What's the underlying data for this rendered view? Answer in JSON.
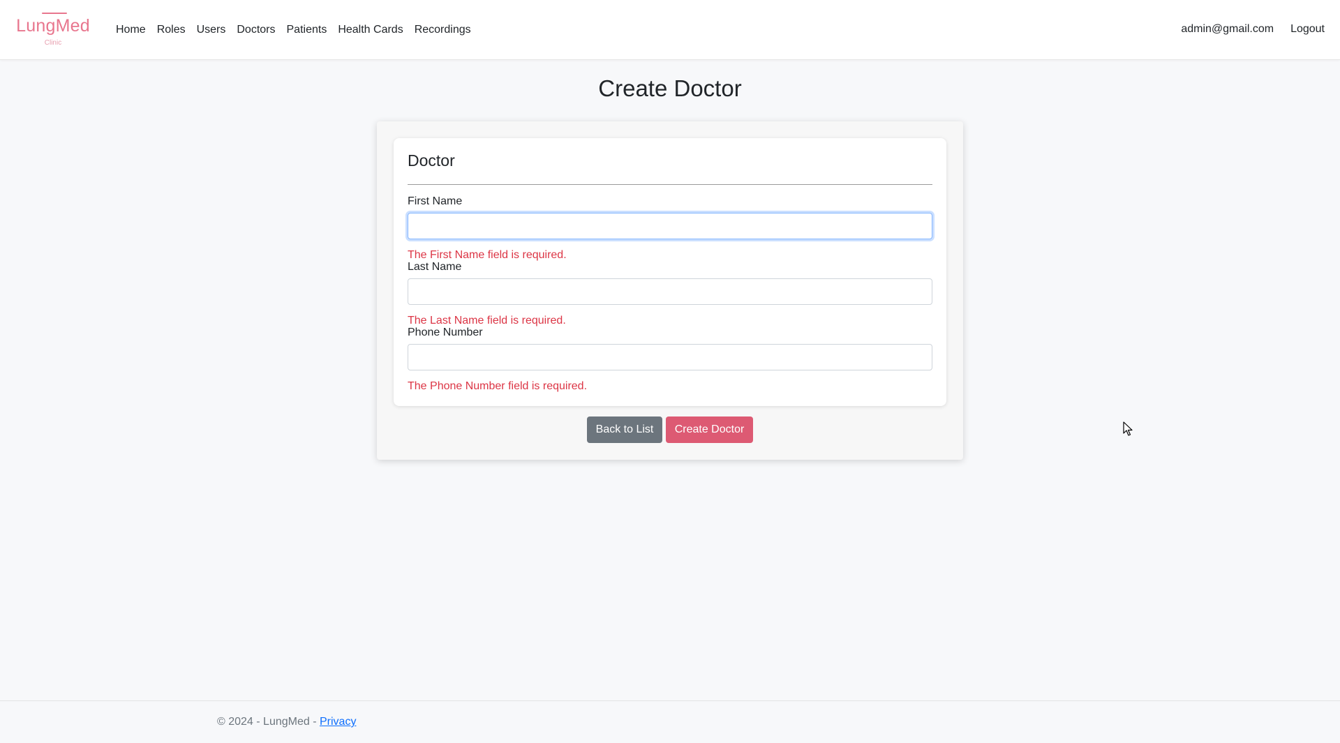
{
  "brand": {
    "name": "LungMed",
    "sub": "Clinic",
    "color": "#e8768e"
  },
  "nav": {
    "items": [
      {
        "label": "Home"
      },
      {
        "label": "Roles"
      },
      {
        "label": "Users"
      },
      {
        "label": "Doctors"
      },
      {
        "label": "Patients"
      },
      {
        "label": "Health Cards"
      },
      {
        "label": "Recordings"
      }
    ],
    "user_email": "admin@gmail.com",
    "logout_label": "Logout"
  },
  "page": {
    "title": "Create Doctor"
  },
  "form": {
    "section_title": "Doctor",
    "fields": [
      {
        "label": "First Name",
        "value": "",
        "error": "The First Name field is required."
      },
      {
        "label": "Last Name",
        "value": "",
        "error": "The Last Name field is required."
      },
      {
        "label": "Phone Number",
        "value": "",
        "error": "The Phone Number field is required."
      }
    ],
    "back_label": "Back to List",
    "submit_label": "Create Doctor"
  },
  "footer": {
    "text": "© 2024 - LungMed - ",
    "privacy_label": "Privacy"
  },
  "colors": {
    "accent": "#dd5a73",
    "secondary": "#6c757d",
    "error": "#dc3545",
    "link": "#0d6efd"
  }
}
